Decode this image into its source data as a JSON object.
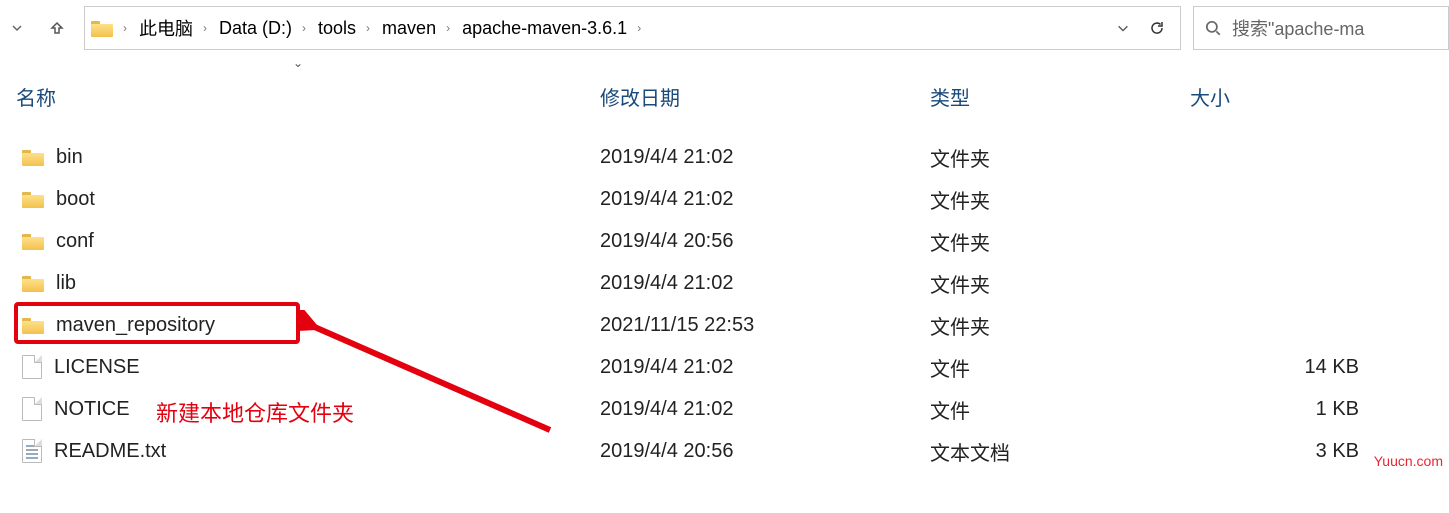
{
  "breadcrumb": {
    "root_icon": "folder-icon",
    "items": [
      "此电脑",
      "Data (D:)",
      "tools",
      "maven",
      "apache-maven-3.6.1"
    ]
  },
  "search": {
    "placeholder": "搜索\"apache-ma"
  },
  "columns": {
    "name": "名称",
    "date": "修改日期",
    "type": "类型",
    "size": "大小"
  },
  "rows": [
    {
      "icon": "folder",
      "name": "bin",
      "date": "2019/4/4 21:02",
      "type": "文件夹",
      "size": ""
    },
    {
      "icon": "folder",
      "name": "boot",
      "date": "2019/4/4 21:02",
      "type": "文件夹",
      "size": ""
    },
    {
      "icon": "folder",
      "name": "conf",
      "date": "2019/4/4 20:56",
      "type": "文件夹",
      "size": ""
    },
    {
      "icon": "folder",
      "name": "lib",
      "date": "2019/4/4 21:02",
      "type": "文件夹",
      "size": ""
    },
    {
      "icon": "folder",
      "name": "maven_repository",
      "date": "2021/11/15 22:53",
      "type": "文件夹",
      "size": ""
    },
    {
      "icon": "file",
      "name": "LICENSE",
      "date": "2019/4/4 21:02",
      "type": "文件",
      "size": "14 KB"
    },
    {
      "icon": "file",
      "name": "NOTICE",
      "date": "2019/4/4 21:02",
      "type": "文件",
      "size": "1 KB"
    },
    {
      "icon": "txt",
      "name": "README.txt",
      "date": "2019/4/4 20:56",
      "type": "文本文档",
      "size": "3 KB"
    }
  ],
  "annotation": {
    "text": "新建本地仓库文件夹"
  },
  "watermark": "Yuucn.com"
}
